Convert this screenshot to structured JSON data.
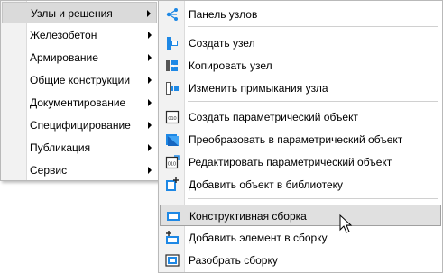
{
  "main_menu": {
    "items": [
      {
        "label": "Узлы и решения",
        "has_submenu": true,
        "selected": true
      },
      {
        "label": "Железобетон",
        "has_submenu": true
      },
      {
        "label": "Армирование",
        "has_submenu": true
      },
      {
        "label": "Общие конструкции",
        "has_submenu": true
      },
      {
        "label": "Документирование",
        "has_submenu": true
      },
      {
        "label": "Специфицирование",
        "has_submenu": true
      },
      {
        "label": "Публикация",
        "has_submenu": true
      },
      {
        "label": "Сервис",
        "has_submenu": true
      }
    ]
  },
  "sub_menu": {
    "items": [
      {
        "label": "Панель узлов",
        "icon": "node-panel-icon"
      },
      {
        "label": "Создать узел",
        "icon": "create-node-icon"
      },
      {
        "label": "Копировать узел",
        "icon": "copy-node-icon"
      },
      {
        "label": "Изменить примыкания узла",
        "icon": "edit-junctions-icon"
      },
      {
        "label": "Создать параметрический объект",
        "icon": "create-parametric-object-icon"
      },
      {
        "label": "Преобразовать в параметрический объект",
        "icon": "convert-to-parametric-icon"
      },
      {
        "label": "Редактировать параметрический объект",
        "icon": "edit-parametric-object-icon"
      },
      {
        "label": "Добавить объект в библиотеку",
        "icon": "add-to-library-icon"
      },
      {
        "label": "Конструктивная сборка",
        "icon": "structural-assembly-icon",
        "highlighted": true
      },
      {
        "label": "Добавить элемент в сборку",
        "icon": "add-element-to-assembly-icon"
      },
      {
        "label": "Разобрать сборку",
        "icon": "disassemble-icon"
      }
    ]
  },
  "colors": {
    "icon_blue": "#1e88e5",
    "icon_dark": "#2b2b2b",
    "highlight": "#e0e0e0"
  }
}
